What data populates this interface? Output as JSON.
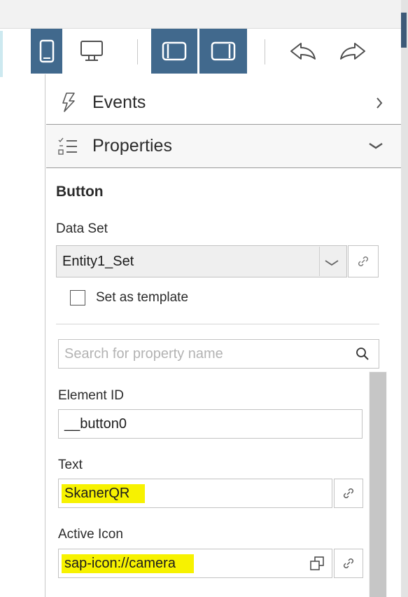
{
  "toolbar": {
    "buttons": [
      {
        "icon": "tablet-icon",
        "active": true
      },
      {
        "icon": "desktop-icon",
        "active": false
      },
      {
        "icon": "panel-left-icon",
        "active": true
      },
      {
        "icon": "panel-right-icon",
        "active": true
      },
      {
        "icon": "undo-icon",
        "active": false
      },
      {
        "icon": "redo-icon",
        "active": false
      }
    ],
    "active_color": "#41698d"
  },
  "sections": {
    "events": {
      "label": "Events",
      "icon": "lightning-icon",
      "chevron": "chevron-right-icon"
    },
    "properties": {
      "label": "Properties",
      "icon": "checklist-icon",
      "chevron": "chevron-down-icon"
    }
  },
  "control": {
    "title": "Button",
    "data_set_label": "Data Set",
    "data_set_value": "Entity1_Set",
    "template_checkbox_label": "Set as template",
    "template_checked": false
  },
  "search": {
    "placeholder": "Search for property name"
  },
  "properties": {
    "element_id_label": "Element ID",
    "element_id_value": "__button0",
    "text_label": "Text",
    "text_value": "SkanerQR",
    "active_icon_label": "Active Icon",
    "active_icon_value": "sap-icon://camera"
  },
  "highlight_color": "#f7f200"
}
